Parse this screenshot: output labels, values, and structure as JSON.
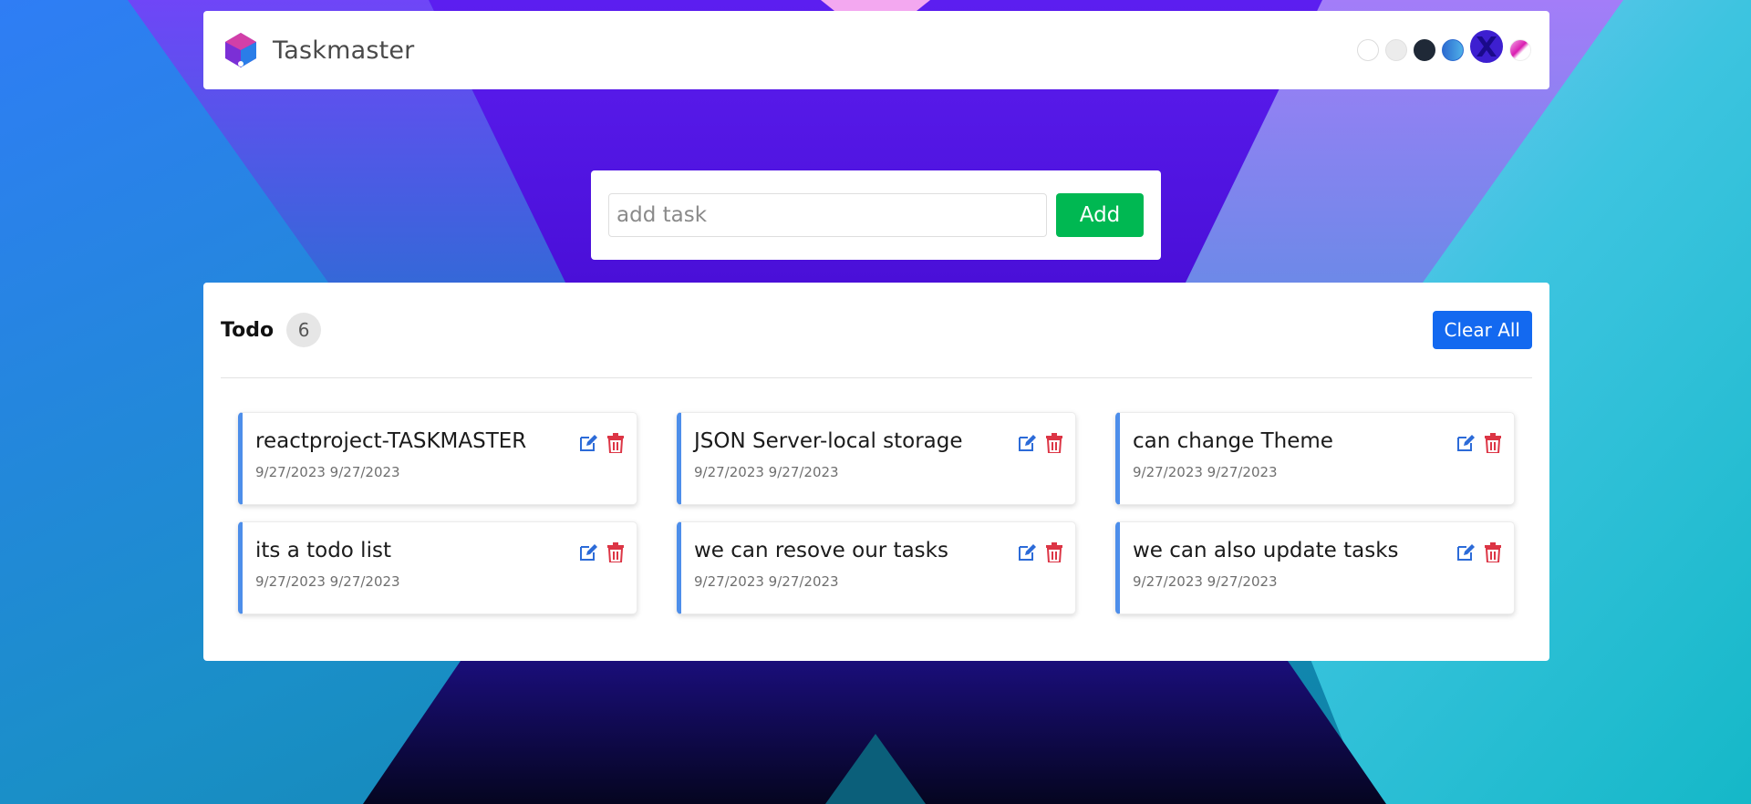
{
  "header": {
    "brand": "Taskmaster",
    "theme_options": [
      "white-theme",
      "light-theme",
      "dark-theme",
      "blue-theme",
      "purple-x-theme",
      "pink-theme"
    ]
  },
  "add_task": {
    "placeholder": "add task",
    "value": "",
    "button_label": "Add"
  },
  "todo": {
    "title": "Todo",
    "count": "6",
    "clear_label": "Clear All",
    "tasks": [
      {
        "title": "reactproject-TASKMASTER",
        "dates": "9/27/2023 9/27/2023"
      },
      {
        "title": "JSON Server-local storage",
        "dates": "9/27/2023 9/27/2023"
      },
      {
        "title": "can change Theme",
        "dates": "9/27/2023 9/27/2023"
      },
      {
        "title": "its a todo list",
        "dates": "9/27/2023 9/27/2023"
      },
      {
        "title": "we can resove our tasks",
        "dates": "9/27/2023 9/27/2023"
      },
      {
        "title": "we can also update tasks",
        "dates": "9/27/2023 9/27/2023"
      }
    ]
  },
  "colors": {
    "add_button": "#00b852",
    "clear_button": "#1369f0",
    "card_accent": "#4d8eea",
    "edit_icon": "#2c6bd8",
    "delete_icon": "#dc3545"
  },
  "icons": {
    "edit": "edit-icon",
    "delete": "trash-icon",
    "logo": "taskmaster-logo-icon"
  }
}
